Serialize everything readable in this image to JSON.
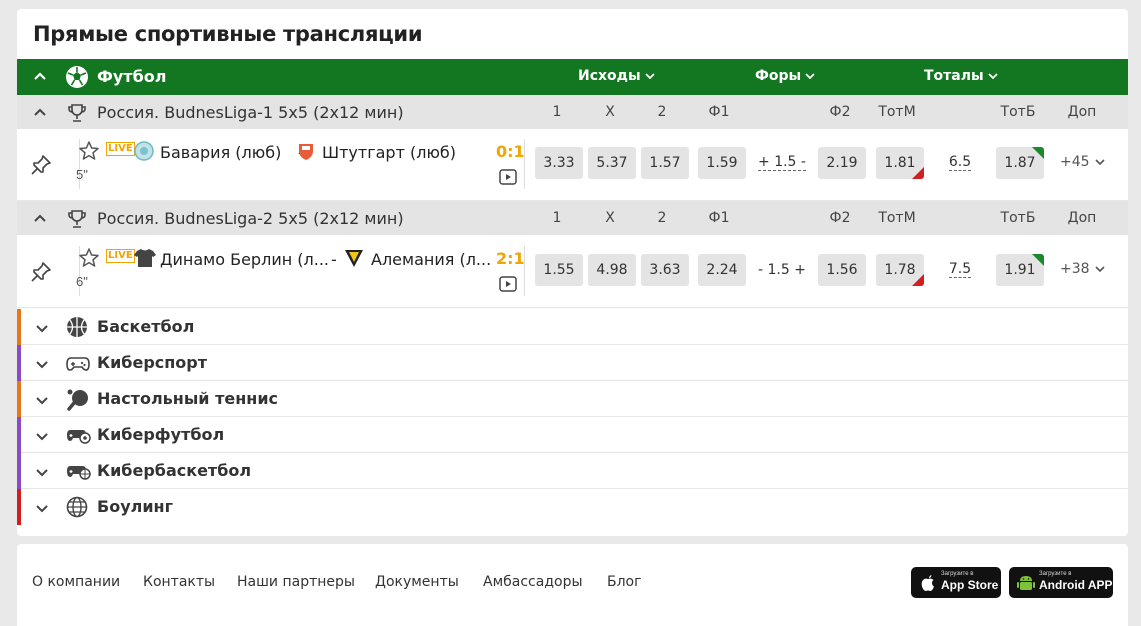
{
  "title": "Прямые спортивные трансляции",
  "sport": {
    "name": "Футбол",
    "dropdowns": [
      "Исходы",
      "Форы",
      "Тоталы"
    ]
  },
  "columns": [
    "1",
    "X",
    "2",
    "Ф1",
    "Ф2",
    "ТотМ",
    "ТотБ",
    "Доп"
  ],
  "leagues": [
    {
      "name": "Россия. BudnesLiga-1 5x5 (2х12 мин)",
      "match": {
        "live": "LIVE",
        "team1": "Бавария (люб)",
        "dash": "-",
        "team2": "Штутгарт (люб)",
        "time": "5\"",
        "score": "0:1",
        "odds": [
          "3.33",
          "5.37",
          "1.57"
        ],
        "f1": "1.59",
        "handicap": "+ 1.5 -",
        "f2": "2.19",
        "totm": "1.81",
        "total": "6.5",
        "totb": "1.87",
        "more": "+45"
      }
    },
    {
      "name": "Россия. BudnesLiga-2 5x5 (2х12 мин)",
      "match": {
        "live": "LIVE",
        "team1": "Динамо Берлин (л...",
        "dash": "-",
        "team2": "Алемания (л...",
        "time": "6\"",
        "score": "2:1",
        "odds": [
          "1.55",
          "4.98",
          "3.63"
        ],
        "f1": "2.24",
        "handicap": "- 1.5 +",
        "f2": "1.56",
        "totm": "1.78",
        "total": "7.5",
        "totb": "1.91",
        "more": "+38"
      }
    }
  ],
  "categories": [
    {
      "name": "Баскетбол",
      "color": "#e8761c"
    },
    {
      "name": "Киберспорт",
      "color": "#8a4bc4"
    },
    {
      "name": "Настольный теннис",
      "color": "#e8761c"
    },
    {
      "name": "Киберфутбол",
      "color": "#8a4bc4"
    },
    {
      "name": "Кибербаскетбол",
      "color": "#8a4bc4"
    },
    {
      "name": "Боулинг",
      "color": "#d21e1e"
    }
  ],
  "footer": {
    "links": [
      "О компании",
      "Контакты",
      "Наши партнеры",
      "Документы",
      "Амбассадоры",
      "Блог"
    ],
    "appstore_small": "Загрузите в",
    "appstore_big": "App Store",
    "android_small": "Загрузите в",
    "android_big": "Android APP"
  },
  "colors": {
    "brand_green": "#137621",
    "live_orange": "#f0a500"
  }
}
